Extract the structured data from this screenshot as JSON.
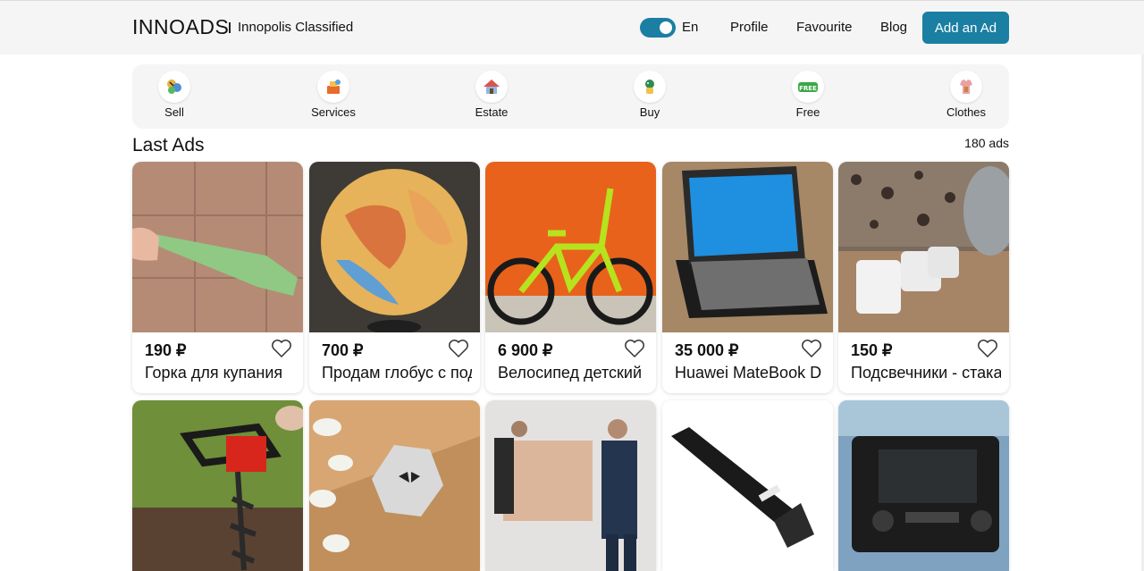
{
  "header": {
    "logo": "INNOADS",
    "tagline": "Innopolis Classified",
    "language": "En",
    "nav": [
      "Profile",
      "Favourite",
      "Blog"
    ],
    "add_button": "Add an Ad",
    "toggle_on": true,
    "accent_color": "#1a7fa2"
  },
  "categories": [
    {
      "label": "Sell",
      "icon": "sell-icon"
    },
    {
      "label": "Services",
      "icon": "services-icon"
    },
    {
      "label": "Estate",
      "icon": "house-icon"
    },
    {
      "label": "Buy",
      "icon": "buy-icon"
    },
    {
      "label": "Free",
      "icon": "free-icon"
    },
    {
      "label": "Clothes",
      "icon": "clothes-icon"
    }
  ],
  "listing": {
    "title": "Last Ads",
    "count": "180 ads"
  },
  "ads": [
    {
      "price": "190 ₽",
      "title": "Горка для купания",
      "image": "green-bath-slide"
    },
    {
      "price": "700 ₽",
      "title": "Продам глобус с подсветкой",
      "image": "illuminated-globe"
    },
    {
      "price": "6 900 ₽",
      "title": "Велосипед детский",
      "image": "kids-bicycle"
    },
    {
      "price": "35 000 ₽",
      "title": "Huawei MateBook D",
      "image": "laptop"
    },
    {
      "price": "150 ₽",
      "title": "Подсвечники - стаканы",
      "image": "candle-holders"
    },
    {
      "price": "",
      "title": "",
      "image": "earth-auger"
    },
    {
      "price": "",
      "title": "",
      "image": "hexagon-tray"
    },
    {
      "price": "",
      "title": "",
      "image": "movers-with-box"
    },
    {
      "price": "",
      "title": "",
      "image": "riser-cable"
    },
    {
      "price": "",
      "title": "",
      "image": "car-head-unit"
    }
  ]
}
